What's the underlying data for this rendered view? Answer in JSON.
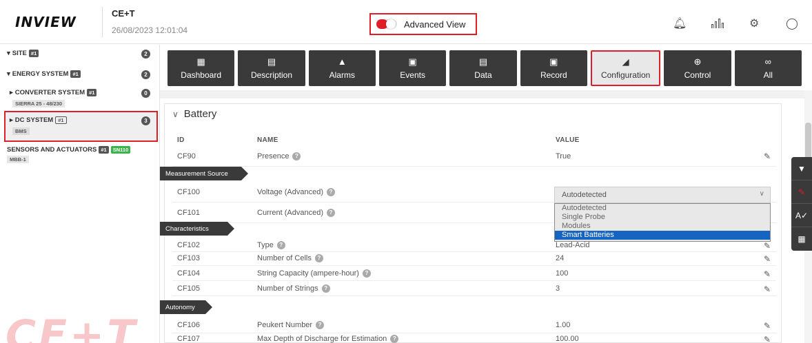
{
  "header": {
    "logo": "INVIEW",
    "site_name": "CE+T",
    "datetime": "26/08/2023 12:01:04",
    "advanced_view_label": "Advanced View",
    "advanced_view_on": true
  },
  "sidebar": {
    "site": {
      "label": "SITE",
      "tag": "#1",
      "count": "2"
    },
    "energy": {
      "label": "ENERGY SYSTEM",
      "tag": "#1",
      "count": "2"
    },
    "converter": {
      "label": "CONVERTER SYSTEM",
      "tag": "#1",
      "count": "0",
      "sub": "SIERRA 25 - 48/230"
    },
    "dc": {
      "label": "DC SYSTEM",
      "tag": "#1",
      "count": "3",
      "sub": "BMS"
    },
    "sensors": {
      "label": "SENSORS AND ACTUATORS",
      "tag": "#1",
      "tag2": "SN110",
      "sub": "MBB-1"
    }
  },
  "nav": {
    "dashboard": "Dashboard",
    "description": "Description",
    "alarms": "Alarms",
    "events": "Events",
    "data": "Data",
    "record": "Record",
    "configuration": "Configuration",
    "control": "Control",
    "all": "All"
  },
  "section": {
    "title": "Battery"
  },
  "columns": {
    "id": "ID",
    "name": "NAME",
    "value": "VALUE"
  },
  "banners": {
    "measurement": "Measurement Source",
    "characteristics": "Characteristics",
    "autonomy": "Autonomy"
  },
  "rows": [
    {
      "id": "CF90",
      "name": "Presence",
      "value": "True"
    },
    {
      "id": "CF100",
      "name": "Voltage (Advanced)",
      "value": "Autodetected"
    },
    {
      "id": "CF101",
      "name": "Current (Advanced)",
      "value": ""
    },
    {
      "id": "CF102",
      "name": "Type",
      "value": "Lead-Acid"
    },
    {
      "id": "CF103",
      "name": "Number of Cells",
      "value": "24"
    },
    {
      "id": "CF104",
      "name": "String Capacity (ampere-hour)",
      "value": "100"
    },
    {
      "id": "CF105",
      "name": "Number of Strings",
      "value": "3"
    },
    {
      "id": "CF106",
      "name": "Peukert Number",
      "value": "1.00"
    },
    {
      "id": "CF107",
      "name": "Max Depth of Discharge for Estimation",
      "value": "100.00"
    }
  ],
  "dropdown": {
    "selected": "Autodetected",
    "options": [
      "Autodetected",
      "Single Probe",
      "Modules",
      "Smart Batteries"
    ],
    "highlighted": "Smart Batteries"
  },
  "colors": {
    "accent": "#e01e26",
    "dark": "#3a3a3a",
    "highlight": "#1565c0",
    "green": "#39b54a"
  }
}
